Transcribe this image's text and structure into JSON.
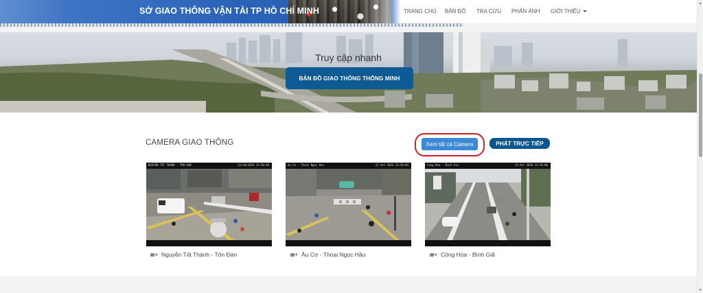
{
  "header": {
    "site_title": "SỞ GIAO THÔNG VẬN TẢI TP HỒ CHÍ MINH",
    "nav": [
      {
        "label": "TRANG CHỦ"
      },
      {
        "label": "BẢN ĐỒ"
      },
      {
        "label": "TRA CỨU"
      },
      {
        "label": "PHẢN ÁNH"
      },
      {
        "label": "GIỚI THIỆU",
        "has_dropdown": true
      }
    ],
    "brand_color": "#2a62b8"
  },
  "hero": {
    "title": "Truy cập nhanh",
    "button_label": "BẢN ĐỒ GIAO THÔNG THÔNG MINH",
    "button_color": "#0e5a94"
  },
  "camera_section": {
    "title": "CAMERA GIAO THÔNG",
    "view_all_label": "Xem tất cả Camera",
    "live_label": "PHÁT TRỰC TIẾP",
    "highlight_color": "#c82027",
    "cameras": [
      {
        "caption": "Nguyễn Tất Thành - Tôn Đản",
        "overlay_left": "NGUYEN TAT THANH - TON DAN",
        "overlay_right": "23/10/2024 13:56:46"
      },
      {
        "caption": "Âu Cơ - Thoại Ngọc Hầu",
        "overlay_left": "Au Co - Thoai Ngoc Hau",
        "overlay_right": "23 Oct 2024 13:56:04"
      },
      {
        "caption": "Cộng Hòa - Bình Giã",
        "overlay_left": "Cong Hoa - Binh Gia",
        "overlay_right": "23 Oct 2024 13:56:00"
      }
    ]
  }
}
